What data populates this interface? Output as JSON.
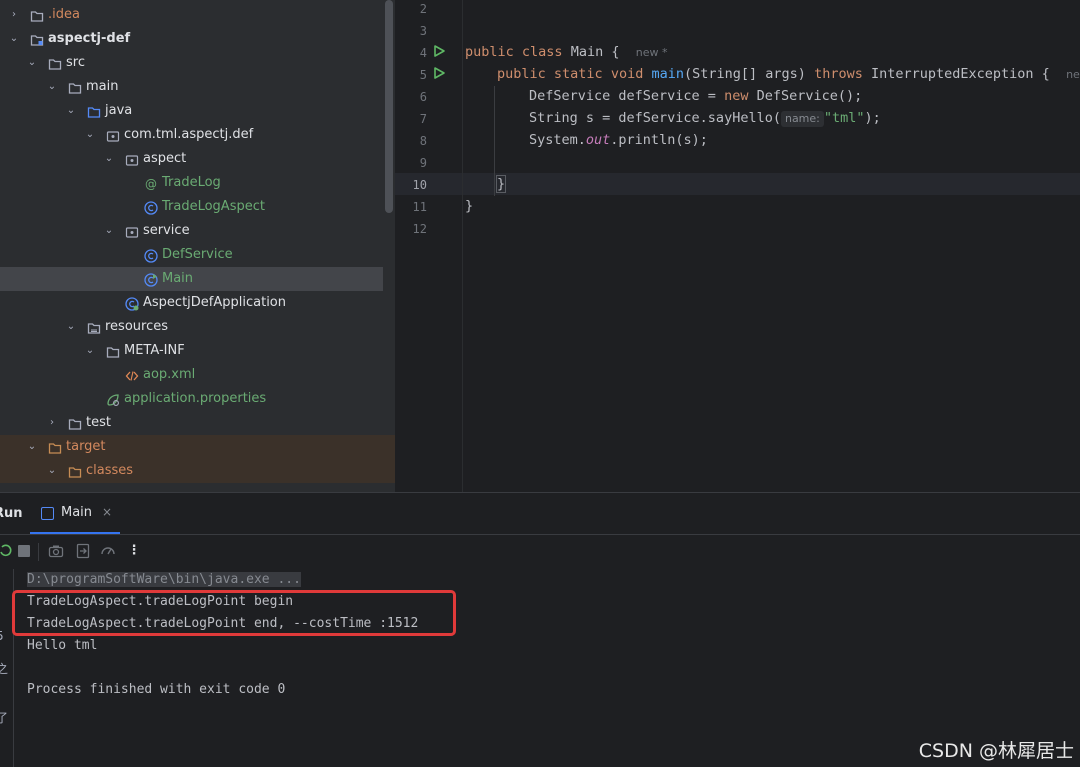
{
  "tree": {
    "items": [
      {
        "label": ".idea",
        "icon": "folder-icon",
        "color": "orange",
        "chev": "›"
      },
      {
        "label": "aspectj-def",
        "icon": "module-folder-icon",
        "color": "default",
        "chev": "⌄",
        "bold": true
      },
      {
        "label": "src",
        "icon": "folder-icon",
        "color": "default",
        "chev": "⌄"
      },
      {
        "label": "main",
        "icon": "folder-icon",
        "color": "default",
        "chev": "⌄"
      },
      {
        "label": "java",
        "icon": "source-folder-icon",
        "color": "default",
        "chev": "⌄"
      },
      {
        "label": "com.tml.aspectj.def",
        "icon": "package-icon",
        "color": "default",
        "chev": "⌄"
      },
      {
        "label": "aspect",
        "icon": "package-icon",
        "color": "default",
        "chev": "⌄"
      },
      {
        "label": "TradeLog",
        "icon": "annotation-icon",
        "color": "green",
        "chev": ""
      },
      {
        "label": "TradeLogAspect",
        "icon": "class-icon",
        "color": "green",
        "chev": ""
      },
      {
        "label": "service",
        "icon": "package-icon",
        "color": "default",
        "chev": "⌄"
      },
      {
        "label": "DefService",
        "icon": "class-icon",
        "color": "green",
        "chev": ""
      },
      {
        "label": "Main",
        "icon": "runnable-class-icon",
        "color": "green",
        "chev": "",
        "selected": true
      },
      {
        "label": "AspectjDefApplication",
        "icon": "spring-boot-class-icon",
        "color": "default",
        "chev": ""
      },
      {
        "label": "resources",
        "icon": "resources-folder-icon",
        "color": "default",
        "chev": "⌄"
      },
      {
        "label": "META-INF",
        "icon": "folder-icon",
        "color": "default",
        "chev": "⌄"
      },
      {
        "label": "aop.xml",
        "icon": "xml-file-icon",
        "color": "green",
        "chev": ""
      },
      {
        "label": "application.properties",
        "icon": "properties-file-icon",
        "color": "green",
        "chev": ""
      },
      {
        "label": "test",
        "icon": "folder-icon",
        "color": "default",
        "chev": "›"
      },
      {
        "label": "target",
        "icon": "excluded-folder-icon",
        "color": "orange",
        "chev": "⌄"
      },
      {
        "label": "classes",
        "icon": "excluded-folder-icon",
        "color": "orange",
        "chev": "⌄"
      }
    ]
  },
  "editor": {
    "line_numbers": [
      "2",
      "3",
      "4",
      "5",
      "6",
      "7",
      "8",
      "9",
      "10",
      "11",
      "12"
    ],
    "current_line": "10",
    "line4": {
      "kw1": "public",
      "kw2": "class",
      "name": " Main {",
      "author": "new *"
    },
    "line5": {
      "kw1": "public",
      "kw2": "static",
      "kw3": "void",
      "method": "main",
      "params": "(String[] args) ",
      "kw4": "throws",
      "exc": " InterruptedException ",
      "brace": "{",
      "author": "new"
    },
    "line6": {
      "text": "DefService defService = ",
      "kw": "new",
      "rest": " DefService();"
    },
    "line7": {
      "text": "String s = defService.sayHello(",
      "hint": "name:",
      "str": "\"tml\"",
      "end": ");"
    },
    "line8": {
      "obj": "System.",
      "field": "out",
      "rest": ".println(s);"
    },
    "line10": {
      "text": "}"
    },
    "line11": {
      "text": "}"
    }
  },
  "run_panel": {
    "title": "Run",
    "tab_label": "Main",
    "tab_close": "×",
    "console": {
      "command": "D:\\programSoftWare\\bin\\java.exe ...",
      "lines": [
        "TradeLogAspect.tradeLogPoint begin",
        "TradeLogAspect.tradeLogPoint end, --costTime :1512",
        "Hello tml",
        "",
        "Process finished with exit code 0"
      ]
    },
    "strip_chars": [
      "5",
      "之",
      "了"
    ]
  },
  "watermark": "CSDN @林犀居士",
  "colors": {
    "accent": "#3574f0",
    "highlight_box": "#e03a3a",
    "green_text": "#6aab73",
    "orange_text": "#d3895e"
  }
}
